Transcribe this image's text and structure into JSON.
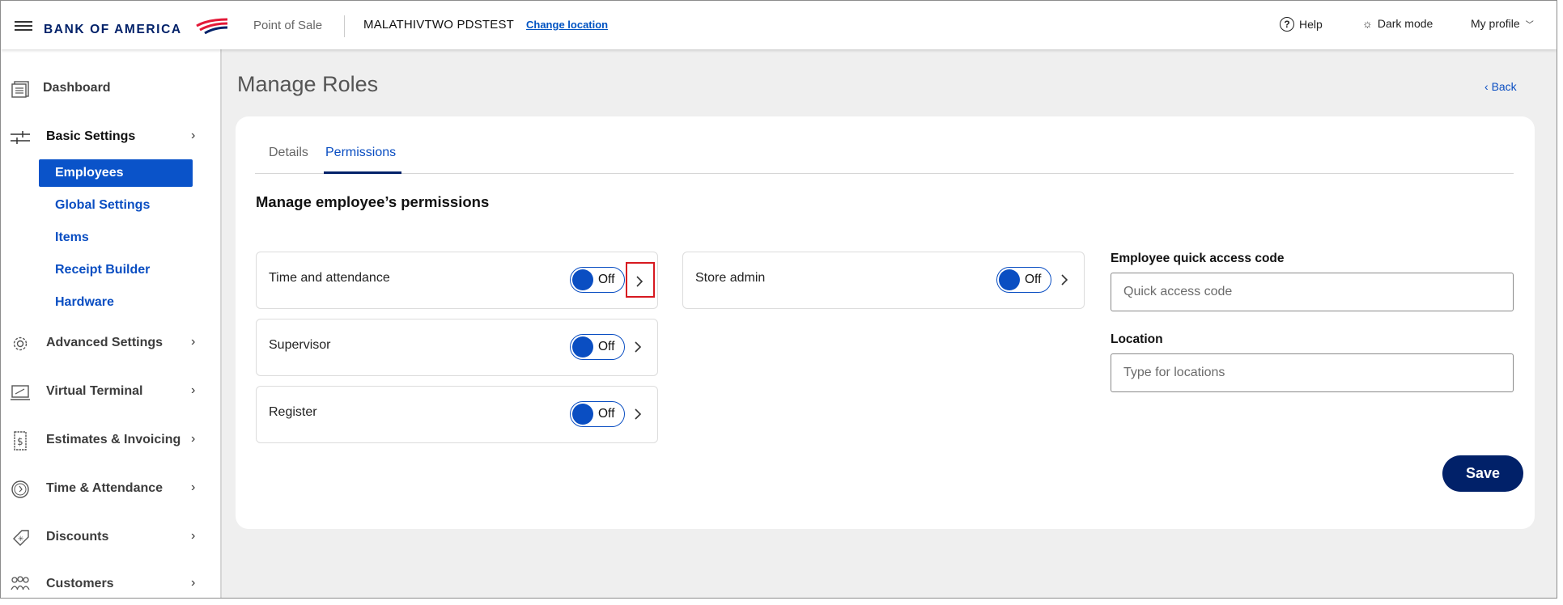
{
  "header": {
    "brand": "BANK OF AMERICA",
    "app_name": "Point of Sale",
    "merchant": "MALATHIVTWO PDSTEST",
    "change_location": "Change location",
    "help": "Help",
    "dark_mode": "Dark mode",
    "my_profile": "My profile"
  },
  "sidebar": {
    "dashboard": "Dashboard",
    "basic_settings": "Basic Settings",
    "sub_items": [
      "Employees",
      "Global Settings",
      "Items",
      "Receipt Builder",
      "Hardware"
    ],
    "advanced_settings": "Advanced Settings",
    "virtual_terminal": "Virtual Terminal",
    "estimates_invoicing": "Estimates & Invoicing",
    "time_attendance": "Time & Attendance",
    "discounts": "Discounts",
    "customers": "Customers"
  },
  "page": {
    "title": "Manage Roles",
    "back": "Back",
    "tabs": [
      "Details",
      "Permissions"
    ],
    "active_tab": "Permissions",
    "section_title": "Manage employee’s permissions"
  },
  "permissions": [
    {
      "label": "Time and attendance",
      "state": "Off"
    },
    {
      "label": "Supervisor",
      "state": "Off"
    },
    {
      "label": "Register",
      "state": "Off"
    },
    {
      "label": "Store admin",
      "state": "Off"
    }
  ],
  "form": {
    "quick_code_label": "Employee quick access code",
    "quick_code_placeholder": "Quick access code",
    "quick_code_value": "",
    "location_label": "Location",
    "location_placeholder": "Type for locations",
    "location_value": "",
    "save": "Save"
  },
  "colors": {
    "brand_navy": "#012169",
    "accent_blue": "#0a4ec2",
    "brand_red": "#e31837",
    "highlight_red": "#d71920"
  }
}
